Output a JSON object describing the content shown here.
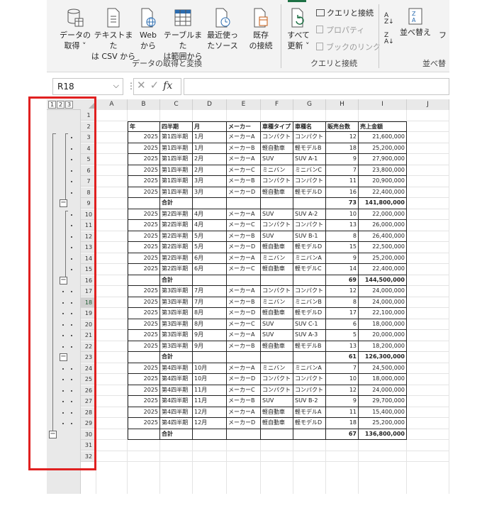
{
  "ribbon": {
    "buttons": [
      {
        "label1": "データの",
        "label2": "取得 ˅",
        "icon": "database-icon"
      },
      {
        "label1": "テキストまた",
        "label2": "は CSV から",
        "icon": "text-file-icon"
      },
      {
        "label1": "Web",
        "label2": "から",
        "icon": "web-icon"
      },
      {
        "label1": "テーブルまた",
        "label2": "は範囲から",
        "icon": "table-icon"
      },
      {
        "label1": "最近使っ",
        "label2": "たソース",
        "icon": "recent-source-icon"
      },
      {
        "label1": "既存",
        "label2": "の接続",
        "icon": "existing-connection-icon"
      },
      {
        "label1": "すべて",
        "label2": "更新 ˅",
        "icon": "refresh-all-icon"
      }
    ],
    "small_items": {
      "queries": "クエリと接続",
      "properties": "プロパティ",
      "workbook_links": "ブックのリンク",
      "sort": "並べ替え",
      "filter_partial": "フ"
    },
    "group_labels": {
      "get_transform": "データの取得と変換",
      "queries_connections": "クエリと接続",
      "sort_filter": "並べ替"
    }
  },
  "formula_bar": {
    "name_box": "R18",
    "formula": ""
  },
  "outline_levels": [
    "1",
    "2",
    "3"
  ],
  "columns": [
    "A",
    "B",
    "C",
    "D",
    "E",
    "F",
    "G",
    "H",
    "I",
    "J"
  ],
  "row_numbers": [
    "1",
    "2",
    "3",
    "4",
    "5",
    "6",
    "7",
    "8",
    "9",
    "10",
    "11",
    "12",
    "13",
    "14",
    "15",
    "16",
    "17",
    "18",
    "19",
    "20",
    "21",
    "22",
    "23",
    "24",
    "25",
    "26",
    "27",
    "28",
    "29",
    "30",
    "31",
    "32"
  ],
  "table": {
    "headers": [
      "年",
      "四半期",
      "月",
      "メーカー",
      "車種タイプ",
      "車種名",
      "販売台数",
      "売上金額"
    ],
    "rows": [
      [
        "2025",
        "第1四半期",
        "1月",
        "メーカーA",
        "コンパクト",
        "コンパクト",
        "12",
        "21,600,000"
      ],
      [
        "2025",
        "第1四半期",
        "1月",
        "メーカーB",
        "軽自動車",
        "軽モデルB",
        "18",
        "25,200,000"
      ],
      [
        "2025",
        "第1四半期",
        "2月",
        "メーカーA",
        "SUV",
        "SUV A-1",
        "9",
        "27,900,000"
      ],
      [
        "2025",
        "第1四半期",
        "2月",
        "メーカーC",
        "ミニバン",
        "ミニバンC",
        "7",
        "23,800,000"
      ],
      [
        "2025",
        "第1四半期",
        "3月",
        "メーカーB",
        "コンパクト",
        "コンパクト",
        "11",
        "20,900,000"
      ],
      [
        "2025",
        "第1四半期",
        "3月",
        "メーカーD",
        "軽自動車",
        "軽モデルD",
        "16",
        "22,400,000"
      ],
      [
        "",
        "合計",
        "",
        "",
        "",
        "",
        "73",
        "141,800,000"
      ],
      [
        "2025",
        "第2四半期",
        "4月",
        "メーカーA",
        "SUV",
        "SUV A-2",
        "10",
        "22,000,000"
      ],
      [
        "2025",
        "第2四半期",
        "4月",
        "メーカーC",
        "コンパクト",
        "コンパクト",
        "13",
        "26,000,000"
      ],
      [
        "2025",
        "第2四半期",
        "5月",
        "メーカーB",
        "SUV",
        "SUV B-1",
        "8",
        "26,400,000"
      ],
      [
        "2025",
        "第2四半期",
        "5月",
        "メーカーD",
        "軽自動車",
        "軽モデルD",
        "15",
        "22,500,000"
      ],
      [
        "2025",
        "第2四半期",
        "6月",
        "メーカーA",
        "ミニバン",
        "ミニバンA",
        "9",
        "25,200,000"
      ],
      [
        "2025",
        "第2四半期",
        "6月",
        "メーカーC",
        "軽自動車",
        "軽モデルC",
        "14",
        "22,400,000"
      ],
      [
        "",
        "合計",
        "",
        "",
        "",
        "",
        "69",
        "144,500,000"
      ],
      [
        "2025",
        "第3四半期",
        "7月",
        "メーカーA",
        "コンパクト",
        "コンパクト",
        "12",
        "24,000,000"
      ],
      [
        "2025",
        "第3四半期",
        "7月",
        "メーカーB",
        "ミニバン",
        "ミニバンB",
        "8",
        "24,000,000"
      ],
      [
        "2025",
        "第3四半期",
        "8月",
        "メーカーD",
        "軽自動車",
        "軽モデルD",
        "17",
        "22,100,000"
      ],
      [
        "2025",
        "第3四半期",
        "8月",
        "メーカーC",
        "SUV",
        "SUV C-1",
        "6",
        "18,000,000"
      ],
      [
        "2025",
        "第3四半期",
        "9月",
        "メーカーA",
        "SUV",
        "SUV A-3",
        "5",
        "20,000,000"
      ],
      [
        "2025",
        "第3四半期",
        "9月",
        "メーカーB",
        "軽自動車",
        "軽モデルB",
        "13",
        "18,200,000"
      ],
      [
        "",
        "合計",
        "",
        "",
        "",
        "",
        "61",
        "126,300,000"
      ],
      [
        "2025",
        "第4四半期",
        "10月",
        "メーカーA",
        "ミニバン",
        "ミニバンA",
        "7",
        "24,500,000"
      ],
      [
        "2025",
        "第4四半期",
        "10月",
        "メーカーD",
        "コンパクト",
        "コンパクト",
        "10",
        "18,000,000"
      ],
      [
        "2025",
        "第4四半期",
        "11月",
        "メーカーC",
        "コンパクト",
        "コンパクト",
        "12",
        "24,000,000"
      ],
      [
        "2025",
        "第4四半期",
        "11月",
        "メーカーB",
        "SUV",
        "SUV B-2",
        "9",
        "29,700,000"
      ],
      [
        "2025",
        "第4四半期",
        "12月",
        "メーカーA",
        "軽自動車",
        "軽モデルA",
        "11",
        "15,400,000"
      ],
      [
        "2025",
        "第4四半期",
        "12月",
        "メーカーD",
        "軽自動車",
        "軽モデルD",
        "18",
        "25,200,000"
      ],
      [
        "",
        "合計",
        "",
        "",
        "",
        "",
        "67",
        "136,800,000"
      ]
    ]
  },
  "collapse_symbol": "−",
  "highlight_color": "#e02020",
  "selected_row": "18"
}
